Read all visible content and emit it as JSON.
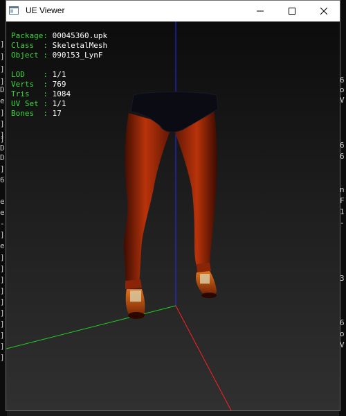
{
  "window": {
    "title": "UE Viewer",
    "accent_color": "#ffffff"
  },
  "icons": {
    "app": "app-window-icon",
    "minimize": "minimize-icon",
    "maximize": "maximize-icon",
    "close": "close-icon"
  },
  "info": {
    "package_key": "Package:",
    "package_value": "00045360.upk",
    "class_key": "Class  :",
    "class_value": "SkeletalMesh",
    "object_key": "Object :",
    "object_value": "090153_LynF",
    "lod_key": "LOD    :",
    "lod_value": "1/1",
    "verts_key": "Verts  :",
    "verts_value": "769",
    "tris_key": "Tris   :",
    "tris_value": "1084",
    "uvset_key": "UV Set :",
    "uvset_value": "1/1",
    "bones_key": "Bones  :",
    "bones_value": "17"
  },
  "background": {
    "left_chars": [
      "]",
      "]",
      "]",
      "]",
      "D",
      "e",
      "]",
      "]",
      "]",
      "]",
      "D",
      "D",
      "]",
      "6",
      "e",
      "e",
      "-",
      "]",
      "e",
      "]",
      "]",
      "]",
      "]",
      "]",
      "]",
      "]",
      "]",
      "]",
      "]",
      "]",
      "]",
      "D",
      "e",
      "]",
      "]"
    ],
    "right_chars": [
      "6",
      "o",
      "V",
      "6",
      "6",
      "n",
      "F",
      "1",
      "-",
      "3",
      "6",
      "o",
      "V"
    ]
  },
  "colors": {
    "info_key": "#3ad93a",
    "info_value": "#ffffff",
    "axis_x": "#ff2020",
    "axis_y": "#20d020",
    "axis_z": "#2020ff",
    "mesh_legs": "#b02a08",
    "mesh_shorts": "#0a0a12"
  }
}
